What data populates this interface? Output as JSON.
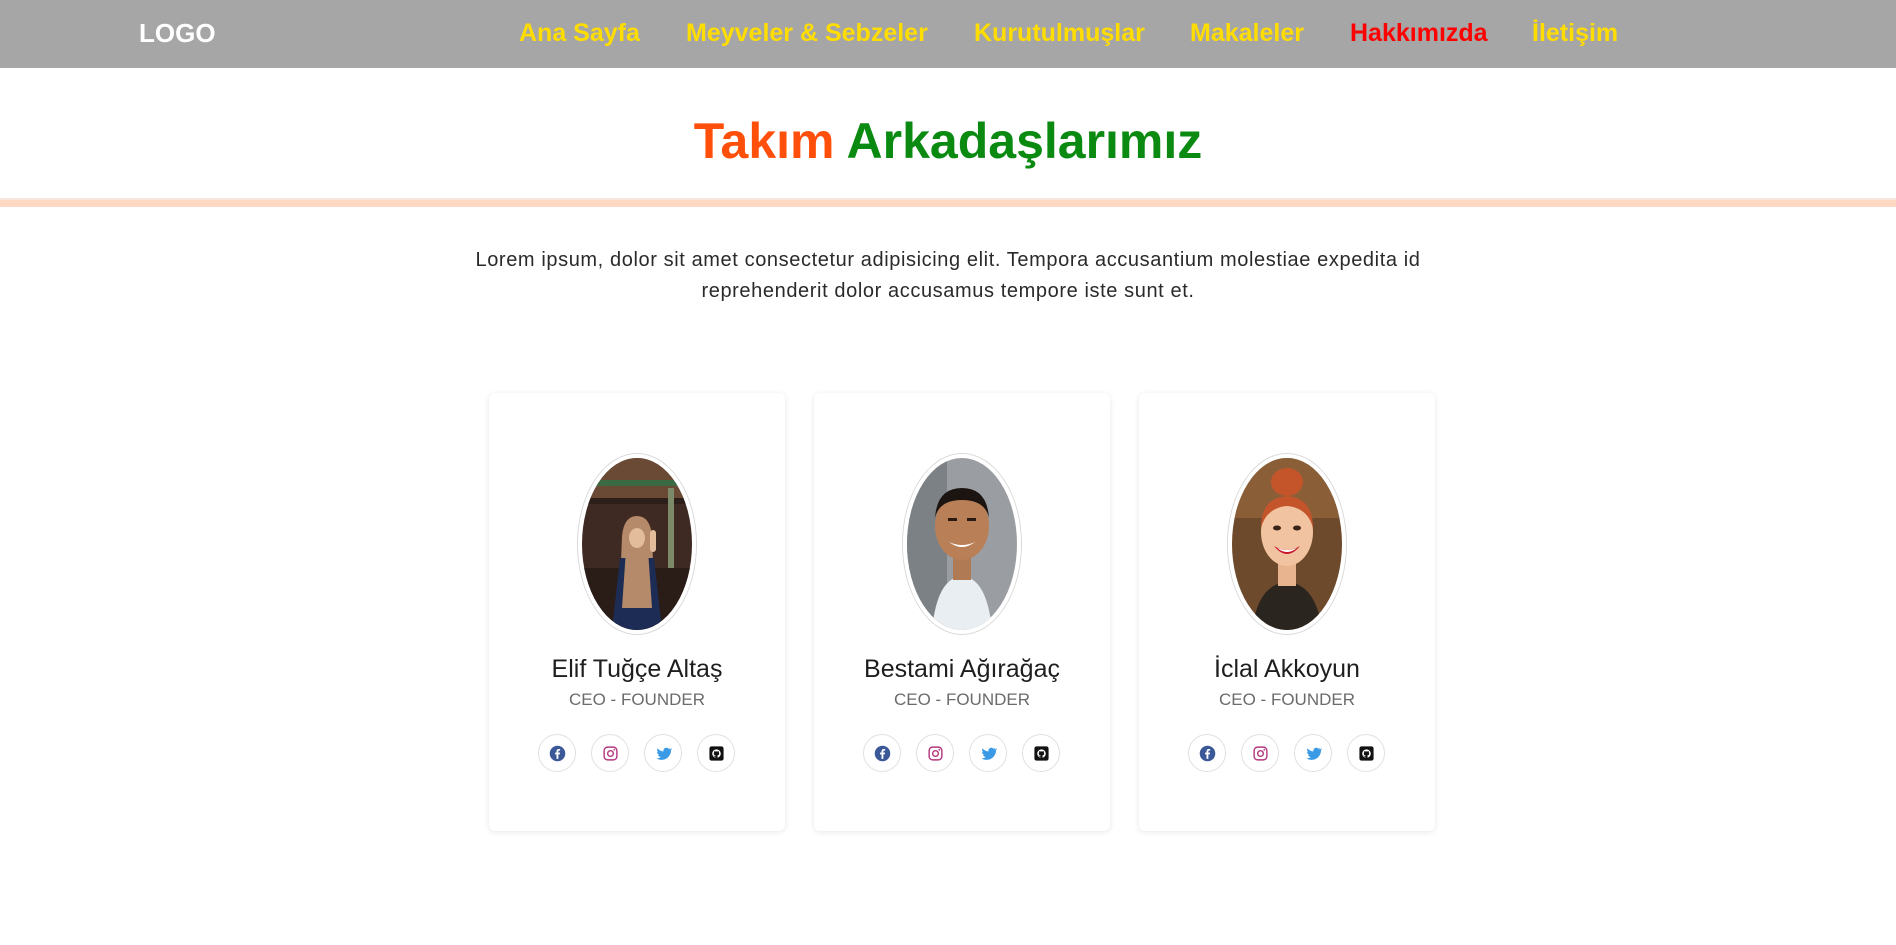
{
  "navbar": {
    "logo": "LOGO",
    "links": [
      {
        "label": "Ana Sayfa",
        "active": false
      },
      {
        "label": "Meyveler & Sebzeler",
        "active": false
      },
      {
        "label": "Kurutulmuşlar",
        "active": false
      },
      {
        "label": "Makaleler",
        "active": false
      },
      {
        "label": "Hakkımızda",
        "active": true
      },
      {
        "label": "İletişim",
        "active": false
      }
    ]
  },
  "section": {
    "title_part1": "Takım",
    "title_part2": "Arkadaşlarımız",
    "intro": "Lorem ipsum, dolor sit amet consectetur adipisicing elit. Tempora accusantium molestiae expedita id reprehenderit dolor accusamus tempore iste sunt et."
  },
  "team": [
    {
      "name": "Elif Tuğçe Altaş",
      "role": "CEO - FOUNDER"
    },
    {
      "name": "Bestami Ağırağaç",
      "role": "CEO - FOUNDER"
    },
    {
      "name": "İclal Akkoyun",
      "role": "CEO - FOUNDER"
    }
  ],
  "socials": [
    {
      "icon": "facebook-icon",
      "color": "#3b5998"
    },
    {
      "icon": "instagram-icon",
      "color": "#b4377e"
    },
    {
      "icon": "twitter-icon",
      "color": "#3a9ae6"
    },
    {
      "icon": "github-icon",
      "color": "#111111"
    }
  ],
  "colors": {
    "navbar_bg": "#a6a6a6",
    "nav_link": "#ffdd00",
    "nav_link_active": "#ff0000",
    "title_part1": "#ff4f0a",
    "title_part2": "#0a8a10",
    "divider": "#ffd8c4"
  }
}
